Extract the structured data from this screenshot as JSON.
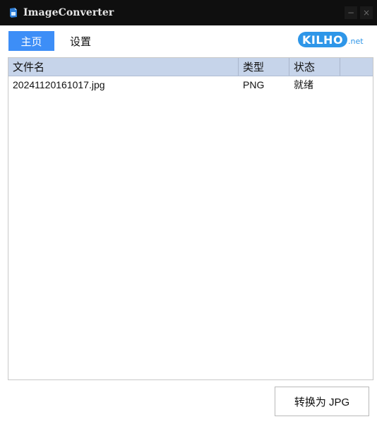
{
  "window": {
    "title": "ImageConverter",
    "minimize_glyph": "−",
    "close_glyph": "×",
    "app_icon": "app-icon"
  },
  "tabs": [
    {
      "label": "主页",
      "active": true
    },
    {
      "label": "设置",
      "active": false
    }
  ],
  "logo": {
    "main": "KILHO",
    "suffix": ".net",
    "color": "#2e96e8"
  },
  "table": {
    "columns": [
      "文件名",
      "类型",
      "状态"
    ],
    "rows": [
      {
        "filename": "20241120161017.jpg",
        "type": "PNG",
        "status": "就绪"
      }
    ]
  },
  "actions": {
    "convert_label": "转换为 JPG"
  },
  "colors": {
    "accent": "#3d8ef7",
    "header_bg": "#c6d4ea",
    "titlebar_bg": "#0f0f0f"
  }
}
